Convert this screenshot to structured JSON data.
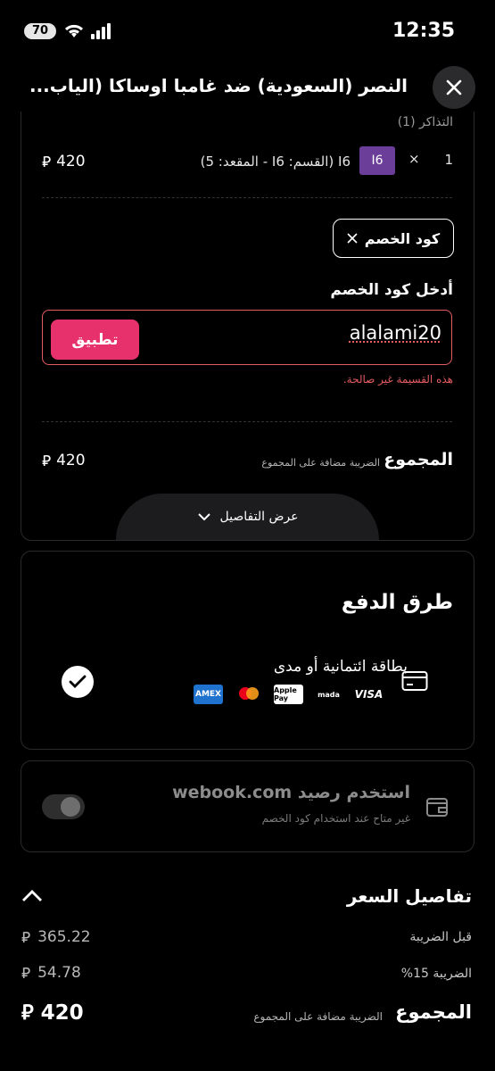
{
  "status": {
    "time": "12:35",
    "battery": "70"
  },
  "header": {
    "title": "النصر (السعودية) ضد غامبا اوساكا (الياب..."
  },
  "tickets": {
    "label": "التذاكر (1)",
    "row": {
      "qty": "1",
      "times": "×",
      "badge": "I6",
      "desc": "I6 (القسم: I6 - المقعد: 5)",
      "price": "420"
    }
  },
  "discount": {
    "chip_label": "كود الخصم",
    "input_label": "أدخل كود الخصم",
    "input_value": "alalami20",
    "apply_label": "تطبيق",
    "error": "هذه القسيمة غير صالحة."
  },
  "summary": {
    "total_label": "المجموع",
    "tax_note": "الضريبة مضافة على المجموع",
    "total": "420",
    "details_label": "عرض التفاصيل"
  },
  "payment": {
    "title": "طرق الدفع",
    "method_label": "بطاقة ائتمانية أو مدى",
    "logos": [
      "VISA",
      "mada",
      "Apple Pay",
      "Mastercard",
      "AMEX"
    ]
  },
  "wallet": {
    "title": "استخدم رصيد webook.com",
    "note": "غير متاح عند استخدام كود الخصم"
  },
  "price_details": {
    "title": "تفاصيل السعر",
    "before_tax_label": "قبل الضريبة",
    "before_tax": "365.22",
    "tax_label": "الضريبة 15%",
    "tax": "54.78",
    "total_label": "المجموع",
    "tax_note": "الضريبة مضافة على المجموع",
    "total": "420"
  },
  "colors": {
    "accent": "#e7316c",
    "error": "#e45c61",
    "badge": "#6b3e99"
  }
}
